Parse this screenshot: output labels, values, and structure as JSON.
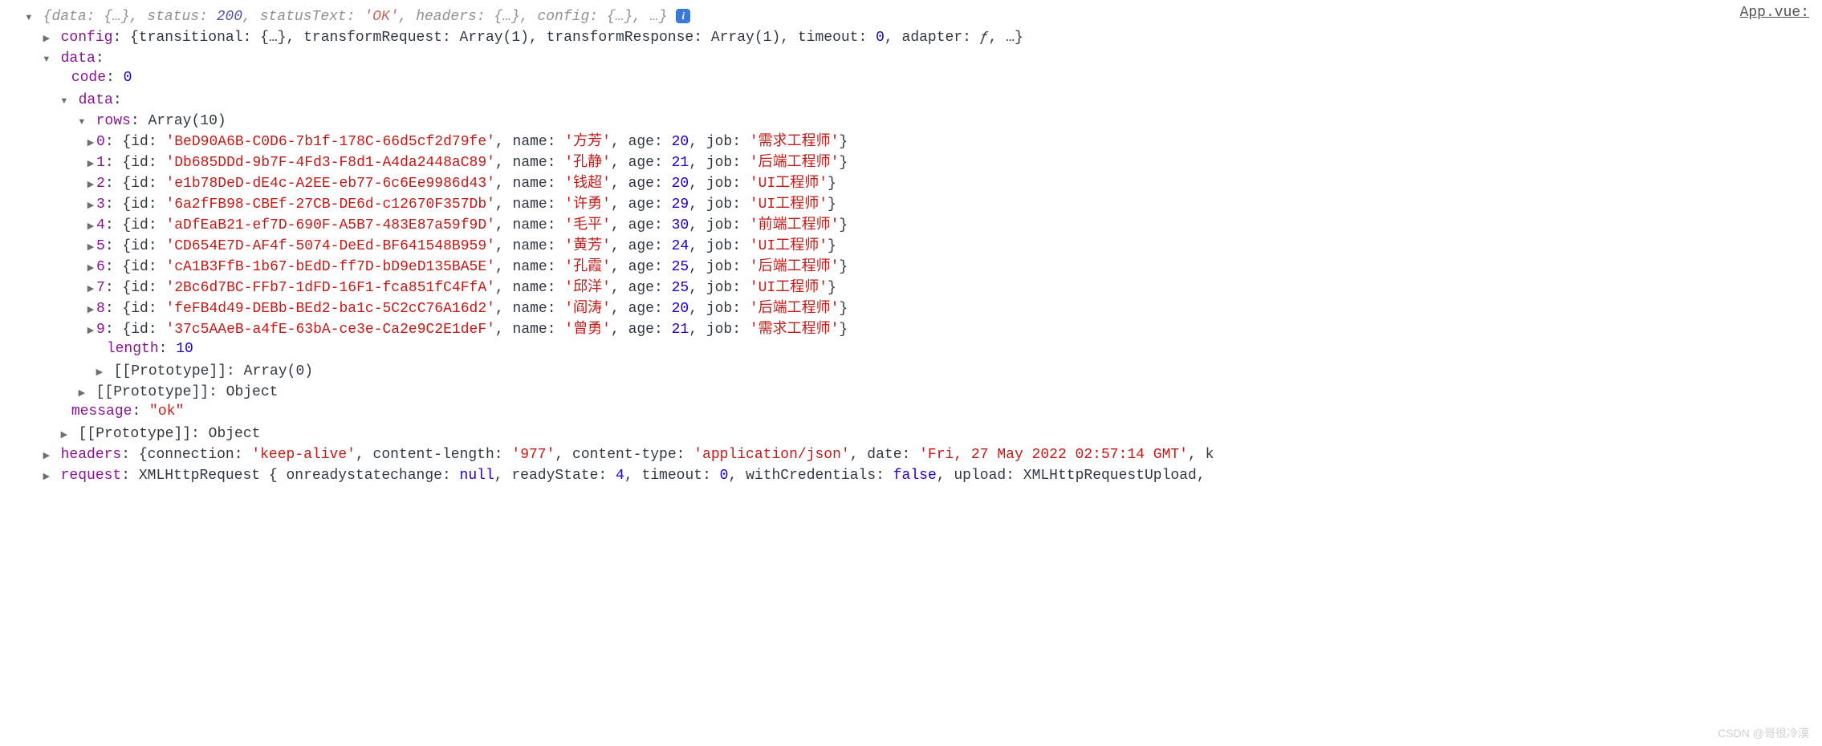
{
  "fileLink": "App.vue:",
  "topPreview": {
    "dataWord": "data",
    "statusWord": "status",
    "statusVal": "200",
    "statusTextWord": "statusText",
    "statusTextVal": "'OK'",
    "headersWord": "headers",
    "configWord": "config"
  },
  "configLine": {
    "key": "config",
    "transitional": "transitional",
    "transformRequest": "transformRequest",
    "transformRequestVal": "Array(1)",
    "transformResponse": "transformResponse",
    "transformResponseVal": "Array(1)",
    "timeout": "timeout",
    "timeoutVal": "0",
    "adapter": "adapter",
    "adapterVal": "ƒ"
  },
  "dataKey": "data",
  "codeKey": "code",
  "codeVal": "0",
  "rowsKey": "rows",
  "rowsType": "Array(10)",
  "rows": [
    {
      "idx": "0",
      "id": "'BeD90A6B-C0D6-7b1f-178C-66d5cf2d79fe'",
      "name": "'方芳'",
      "age": "20",
      "job": "'需求工程师'"
    },
    {
      "idx": "1",
      "id": "'Db685DDd-9b7F-4Fd3-F8d1-A4da2448aC89'",
      "name": "'孔静'",
      "age": "21",
      "job": "'后端工程师'"
    },
    {
      "idx": "2",
      "id": "'e1b78DeD-dE4c-A2EE-eb77-6c6Ee9986d43'",
      "name": "'钱超'",
      "age": "20",
      "job": "'UI工程师'"
    },
    {
      "idx": "3",
      "id": "'6a2fFB98-CBEf-27CB-DE6d-c12670F357Db'",
      "name": "'许勇'",
      "age": "29",
      "job": "'UI工程师'"
    },
    {
      "idx": "4",
      "id": "'aDfEaB21-ef7D-690F-A5B7-483E87a59f9D'",
      "name": "'毛平'",
      "age": "30",
      "job": "'前端工程师'"
    },
    {
      "idx": "5",
      "id": "'CD654E7D-AF4f-5074-DeEd-BF641548B959'",
      "name": "'黄芳'",
      "age": "24",
      "job": "'UI工程师'"
    },
    {
      "idx": "6",
      "id": "'cA1B3FfB-1b67-bEdD-ff7D-bD9eD135BA5E'",
      "name": "'孔霞'",
      "age": "25",
      "job": "'后端工程师'"
    },
    {
      "idx": "7",
      "id": "'2Bc6d7BC-FFb7-1dFD-16F1-fca851fC4FfA'",
      "name": "'邱洋'",
      "age": "25",
      "job": "'UI工程师'"
    },
    {
      "idx": "8",
      "id": "'feFB4d49-DEBb-BEd2-ba1c-5C2cC76A16d2'",
      "name": "'阎涛'",
      "age": "20",
      "job": "'后端工程师'"
    },
    {
      "idx": "9",
      "id": "'37c5AAeB-a4fE-63bA-ce3e-Ca2e9C2E1deF'",
      "name": "'曾勇'",
      "age": "21",
      "job": "'需求工程师'"
    }
  ],
  "labels": {
    "id": "id",
    "name": "name",
    "age": "age",
    "job": "job"
  },
  "lengthKey": "length",
  "lengthVal": "10",
  "protoKey": "[[Prototype]]",
  "protoArr0": "Array(0)",
  "protoObj": "Object",
  "messageKey": "message",
  "messageVal": "\"ok\"",
  "headersLine": {
    "key": "headers",
    "connection": "connection",
    "connectionVal": "'keep-alive'",
    "contentLength": "content-length",
    "contentLengthVal": "'977'",
    "contentType": "content-type",
    "contentTypeVal": "'application/json'",
    "date": "date",
    "dateVal": "'Fri, 27 May 2022 02:57:14 GMT'",
    "trail": "k"
  },
  "requestLine": {
    "key": "request",
    "prefix": "XMLHttpRequest {",
    "onreadystatechange": "onreadystatechange",
    "onreadystatechangeVal": "null",
    "readyState": "readyState",
    "readyStateVal": "4",
    "timeout": "timeout",
    "timeoutVal": "0",
    "withCredentials": "withCredentials",
    "withCredentialsVal": "false",
    "upload": "upload",
    "uploadVal": "XMLHttpRequestUpload,"
  },
  "watermark": "CSDN @哥很冷漠"
}
